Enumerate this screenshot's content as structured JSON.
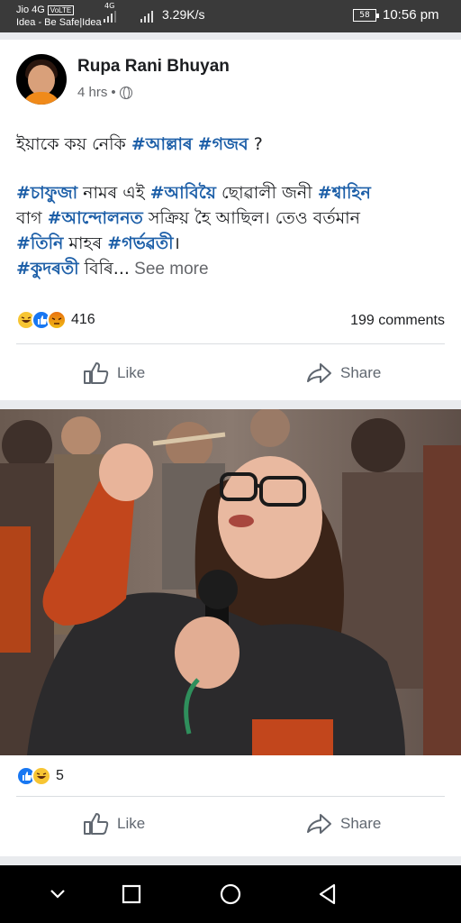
{
  "status_bar": {
    "carrier1": "Jio 4G",
    "volte": "VoLTE",
    "carrier2": "Idea - Be Safe|Idea",
    "network": "4G",
    "speed": "3.29K/s",
    "battery": "58",
    "time": "10:56 pm"
  },
  "post": {
    "author": "Rupa Rani Bhuyan",
    "time": "4 hrs",
    "privacy_icon": "globe-icon",
    "line1_plain": "ইয়াকে কয় নেকি ",
    "line1_tag1": "#আল্লাৰ",
    "line1_tag2": "#গজব",
    "line1_end": " ?",
    "b_tag1": "#চাফুজা",
    "b_text1": " নামৰ এই ",
    "b_tag2": "#আবিয়ৈ",
    "b_text2": " ছোৱালী জনী ",
    "b_tag3": "#শ্বাহিন",
    "b_text3": "বাগ ",
    "b_tag4": "#আন্দোলনত",
    "b_text4": "  সক্ৰিয় হৈ আছিল। তেও বৰ্তমান",
    "b_tag5": "#তিনি",
    "b_text5": " মাহৰ ",
    "b_tag6": "#গৰ্ভৱতী",
    "b_text6": "।",
    "b_tag7": "#কুদৰতী",
    "b_text7": " বিৰি...",
    "see_more": " See more",
    "reaction_count": "416",
    "comments": "199 comments",
    "like_label": "Like",
    "share_label": "Share"
  },
  "photo_post": {
    "reaction_count": "5",
    "like_label": "Like",
    "share_label": "Share"
  },
  "colors": {
    "link": "#1d5fa8",
    "like_blue": "#1877f2",
    "muted": "#65676b"
  }
}
